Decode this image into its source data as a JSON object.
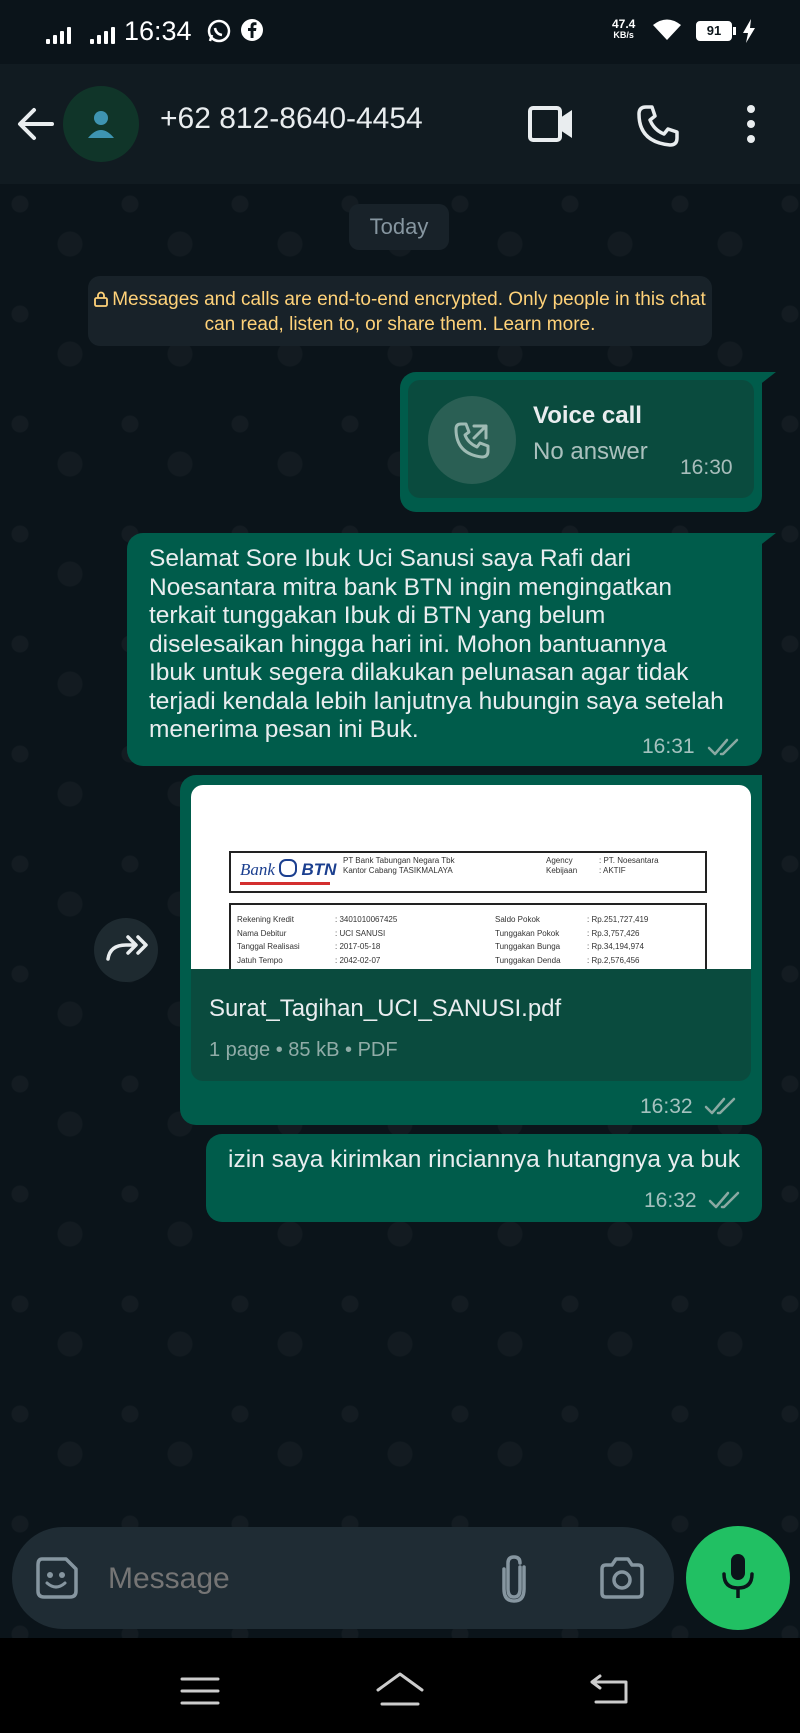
{
  "status_bar": {
    "time": "16:34",
    "net_speed_value": "47.4",
    "net_speed_unit": "KB/s",
    "battery": "91"
  },
  "header": {
    "contact_name": "+62 812-8640-4454",
    "icons": [
      "back-arrow-icon",
      "avatar-icon",
      "video-call-icon",
      "phone-icon",
      "more-options-icon"
    ]
  },
  "chat": {
    "date_chip": "Today",
    "encryption_notice": "Messages and calls are end-to-end encrypted. Only people in this chat can read, listen to, or share them. Learn more.",
    "messages": [
      {
        "type": "call",
        "title": "Voice call",
        "subtitle": "No answer",
        "time": "16:30"
      },
      {
        "type": "text",
        "lines": [
          "Selamat Sore Ibuk Uci Sanusi saya Rafi dari",
          "Noesantara mitra bank BTN ingin mengingatkan",
          "terkait tunggakan Ibuk di BTN yang belum",
          "diselesaikan hingga hari ini. Mohon bantuannya",
          "Ibuk untuk segera dilakukan pelunasan agar tidak",
          "terjadi kendala lebih lanjutnya hubungin saya setelah",
          "menerima pesan ini Buk."
        ],
        "time": "16:31"
      },
      {
        "type": "document",
        "preview": {
          "bank_logo_text": "Bank",
          "bank_logo_brand": "BTN",
          "company_line1": "PT Bank Tabungan Negara Tbk",
          "company_line2": "Kantor Cabang TASIKMALAYA",
          "agency_label": "Agency",
          "agency_value": ": PT. Noesantara",
          "kebijakan_label": "Kebijaan",
          "kebijakan_value": ": AKTIF",
          "rows": [
            {
              "l1": "Rekening Kredit",
              "v1": ": 3401010067425",
              "l2": "Saldo Pokok",
              "v2": ": Rp.251,727,419"
            },
            {
              "l1": "Nama Debitur",
              "v1": ": UCI SANUSI",
              "l2": "Tunggakan Pokok",
              "v2": ": Rp.3,757,426"
            },
            {
              "l1": "Tanggal Realisasi",
              "v1": ": 2017-05-18",
              "l2": "Tunggakan Bunga",
              "v2": ": Rp.34,194,974"
            },
            {
              "l1": "Jatuh Tempo",
              "v1": ": 2042-02-07",
              "l2": "Tunggakan Denda",
              "v2": ": Rp.2,576,456"
            }
          ]
        },
        "filename": "Surat_Tagihan_UCI_SANUSI.pdf",
        "pages": "1 page",
        "size": "85 kB",
        "filetype": "PDF",
        "time": "16:32"
      },
      {
        "type": "text",
        "lines": [
          "izin saya kirimkan rinciannya hutangnya ya buk"
        ],
        "time": "16:32"
      }
    ]
  },
  "composer": {
    "placeholder": "Message",
    "icons": [
      "sticker-icon",
      "attach-icon",
      "camera-icon",
      "mic-icon"
    ]
  },
  "colors": {
    "background": "#0b141a",
    "header": "#111b21",
    "outgoing_bubble": "#005c4b",
    "accent_green": "#21c063",
    "encryption_text": "#ffd279"
  }
}
